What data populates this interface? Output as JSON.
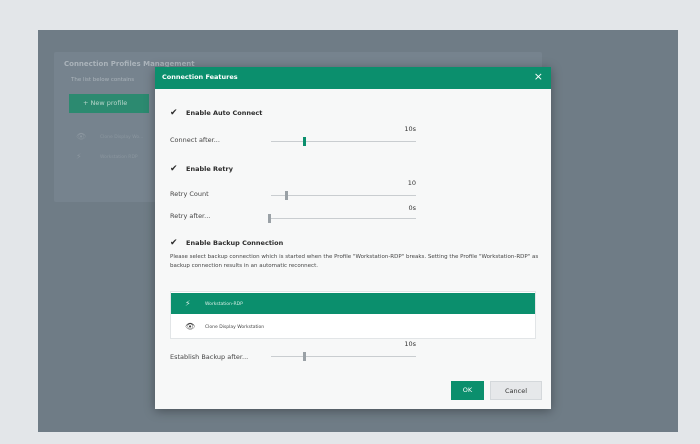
{
  "background": {
    "title": "Connection Profiles Management",
    "description": "The list below contains",
    "new_profile_label": "+ New profile",
    "items": [
      {
        "icon": "eye-icon",
        "label": "Clone Display Wo..."
      },
      {
        "icon": "lightning-icon",
        "label": "Workstation RDP"
      }
    ]
  },
  "dialog": {
    "title": "Connection Features",
    "close_glyph": "×",
    "auto_connect": {
      "label": "Enable Auto Connect",
      "connect_after_label": "Connect after...",
      "connect_after_value": "10s",
      "connect_after_level": 0.23
    },
    "retry": {
      "label": "Enable Retry",
      "count_label": "Retry Count",
      "count_value": "10",
      "count_level": 0.1,
      "after_label": "Retry after...",
      "after_value": "0s",
      "after_level": 0.0
    },
    "backup": {
      "label": "Enable Backup Connection",
      "description": "Please select backup connection which is started when the Profile \"Workstation-RDP\" breaks. Setting the Profile \"Workstation-RDP\" as backup connection results in an automatic reconnect.",
      "options": [
        {
          "icon": "lightning-icon",
          "label": "Workstation-RDP",
          "selected": true
        },
        {
          "icon": "eye-icon",
          "label": "Clone Display Workstation",
          "selected": false
        }
      ],
      "establish_label": "Establish Backup after...",
      "establish_value": "10s",
      "establish_level": 0.23
    },
    "ok_label": "OK",
    "cancel_label": "Cancel"
  },
  "colors": {
    "accent": "#0b8f6d",
    "overlay": "#6f7c86",
    "frame": "#e3e6e9"
  }
}
